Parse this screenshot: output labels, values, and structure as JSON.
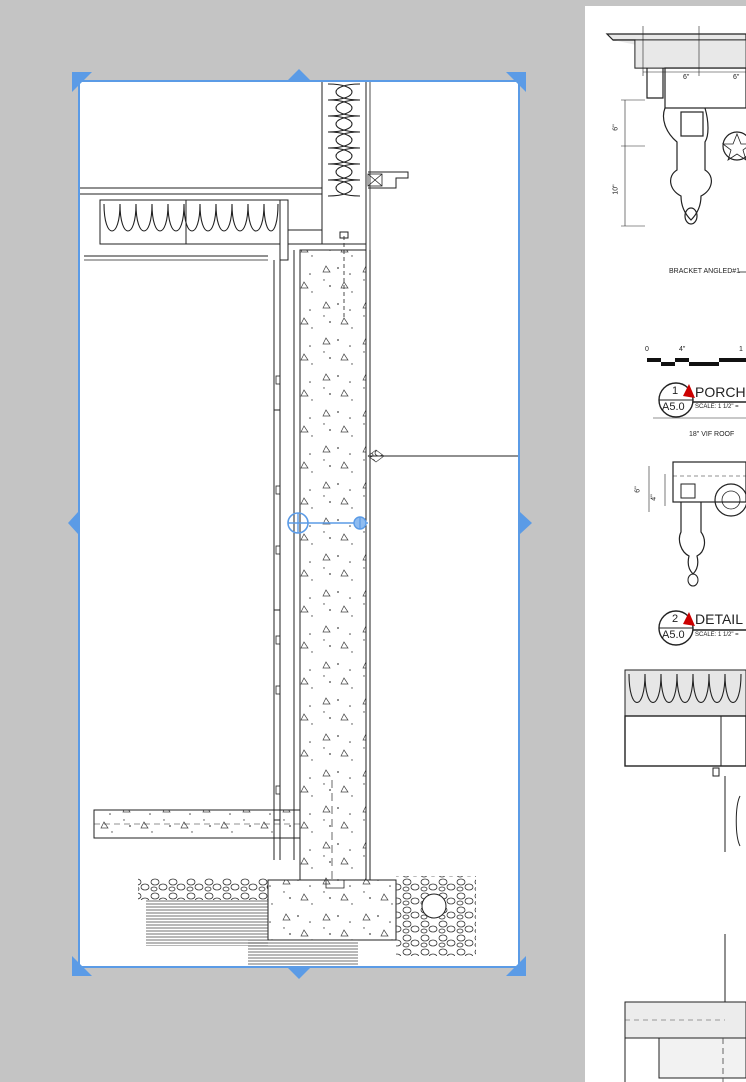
{
  "canvas": {
    "background_color": "#c4c4c4",
    "selection_color": "#5b9be6"
  },
  "sheet": {
    "dim_6a": "6\"",
    "dim_6b": "6\"",
    "dim_6_vert": "6\"",
    "dim_10_vert": "10\"",
    "bracket_label": "BRACKET ANGLED#1",
    "scale_0": "0",
    "scale_4": "4\"",
    "scale_1": "1",
    "detail1_number": "1",
    "detail1_sheet": "A5.0",
    "detail1_title": "PORCH",
    "detail1_scale": "SCALE: 1 1/2\" =",
    "roof_note": "18\" VIF ROOF",
    "dim_6_vert2": "6\"",
    "dim_4_vert": "4\"",
    "detail2_number": "2",
    "detail2_sheet": "A5.0",
    "detail2_title": "DETAIL S",
    "detail2_scale": "SCALE: 1 1/2\" ="
  }
}
